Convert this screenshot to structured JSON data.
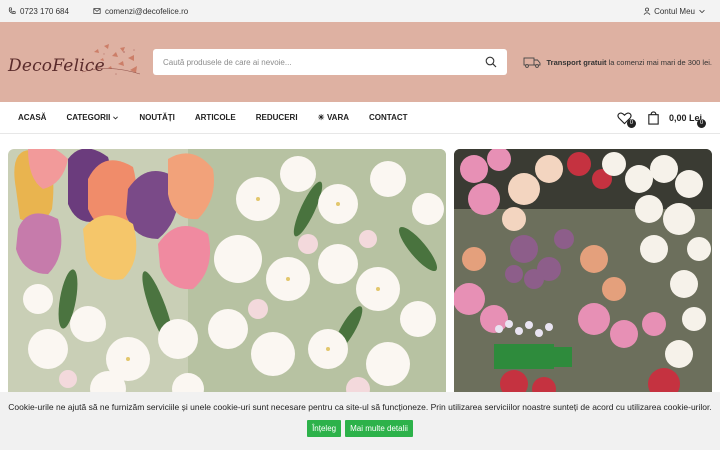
{
  "topbar": {
    "phone": "0723 170 684",
    "email": "comenzi@decofelice.ro",
    "account": "Contul Meu"
  },
  "header": {
    "logo_text": "DecoFelice",
    "search_placeholder": "Caută produsele de care ai nevoie...",
    "shipping_bold": "Transport gratuit",
    "shipping_rest": " la comenzi mai mari de 300 lei."
  },
  "nav": {
    "items": [
      "ACASĂ",
      "CATEGORII",
      "NOUTĂȚI",
      "ARTICOLE",
      "REDUCERI",
      "☀ VARA",
      "CONTACT"
    ],
    "wishlist_count": "0",
    "cart_count": "0",
    "cart_total": "0,00 Lei"
  },
  "cookie": {
    "text": "Cookie-urile ne ajută să ne furnizăm serviciile și unele cookie-uri sunt necesare pentru ca site-ul să funcționeze. Prin utilizarea serviciilor noastre sunteți de acord cu utilizarea cookie-urilor.",
    "accept": "Înțeleg",
    "more": "Mai multe detalii"
  },
  "colors": {
    "header_bg": "#deb1a2",
    "accent_green": "#2db24a",
    "logo": "#5a2b2b"
  }
}
